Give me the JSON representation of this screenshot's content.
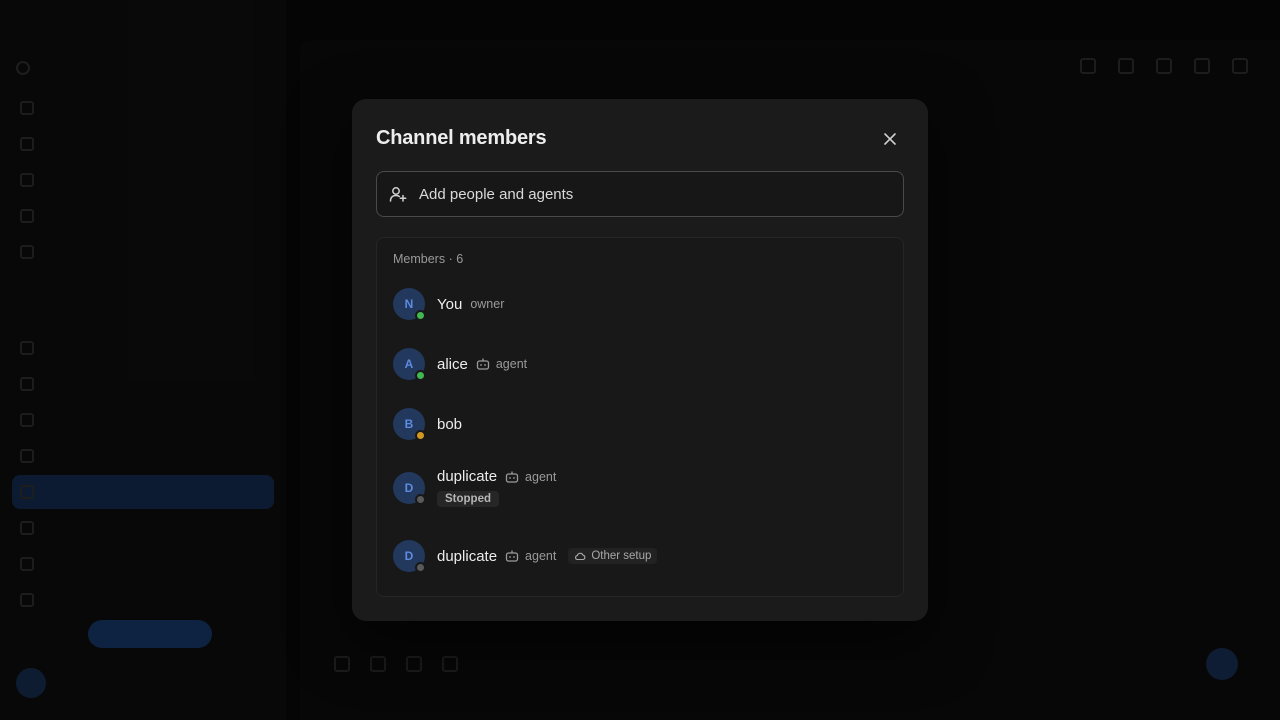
{
  "modal": {
    "title": "Channel members",
    "add_placeholder": "Add people and agents",
    "members_header": "Members · 6",
    "members": [
      {
        "initial": "N",
        "name": "You",
        "role": "owner",
        "status_color": "#3fb950"
      },
      {
        "initial": "A",
        "name": "alice",
        "agent_label": "agent",
        "status_color": "#3fb950"
      },
      {
        "initial": "B",
        "name": "bob",
        "status_color": "#d29922"
      },
      {
        "initial": "D",
        "name": "duplicate",
        "agent_label": "agent",
        "badge": "Stopped",
        "status_color": "#5a5a5a"
      },
      {
        "initial": "D",
        "name": "duplicate",
        "agent_label": "agent",
        "setup_label": "Other setup",
        "status_color": "#5a5a5a"
      }
    ]
  },
  "colors": {
    "accent": "#2f6bd1",
    "online": "#3fb950",
    "away": "#d29922",
    "offline": "#5a5a5a"
  }
}
